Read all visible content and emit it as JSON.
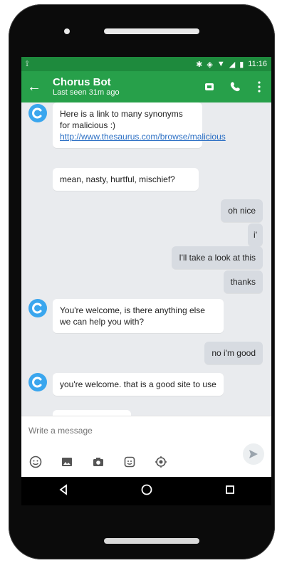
{
  "status_bar": {
    "time": "11:16"
  },
  "app_bar": {
    "title": "Chorus Bot",
    "subtitle": "Last seen 31m ago"
  },
  "messages": [
    {
      "from": "bot",
      "text_before": "Here is a link to many synonyms for malicious :) ",
      "link": "http://www.thesaurus.com/browse/malicious"
    },
    {
      "from": "bot",
      "text": "mean, nasty, hurtful, mischief?"
    },
    {
      "from": "me",
      "text": "oh nice"
    },
    {
      "from": "me",
      "text": "i'"
    },
    {
      "from": "me",
      "text": "I'll take a look at this"
    },
    {
      "from": "me",
      "text": "thanks"
    },
    {
      "from": "bot",
      "text": "You're welcome, is there anything else we can help you with?"
    },
    {
      "from": "me",
      "text": "no i'm good"
    },
    {
      "from": "bot",
      "text": "you're welcome.  that is a good site to use"
    }
  ],
  "compose": {
    "placeholder": "Write a message"
  },
  "icons": {
    "back": "arrow-left-icon",
    "video": "video-icon",
    "call": "phone-icon",
    "more": "more-vert-icon",
    "emoji": "emoji-icon",
    "gallery": "image-icon",
    "camera": "camera-icon",
    "sticker": "sticker-icon",
    "location": "location-icon",
    "send": "send-icon"
  },
  "colors": {
    "status": "#1e8a3d",
    "appbar": "#27a04a",
    "avatar": "#3aa6ee",
    "chat_bg": "#e9ebee"
  }
}
